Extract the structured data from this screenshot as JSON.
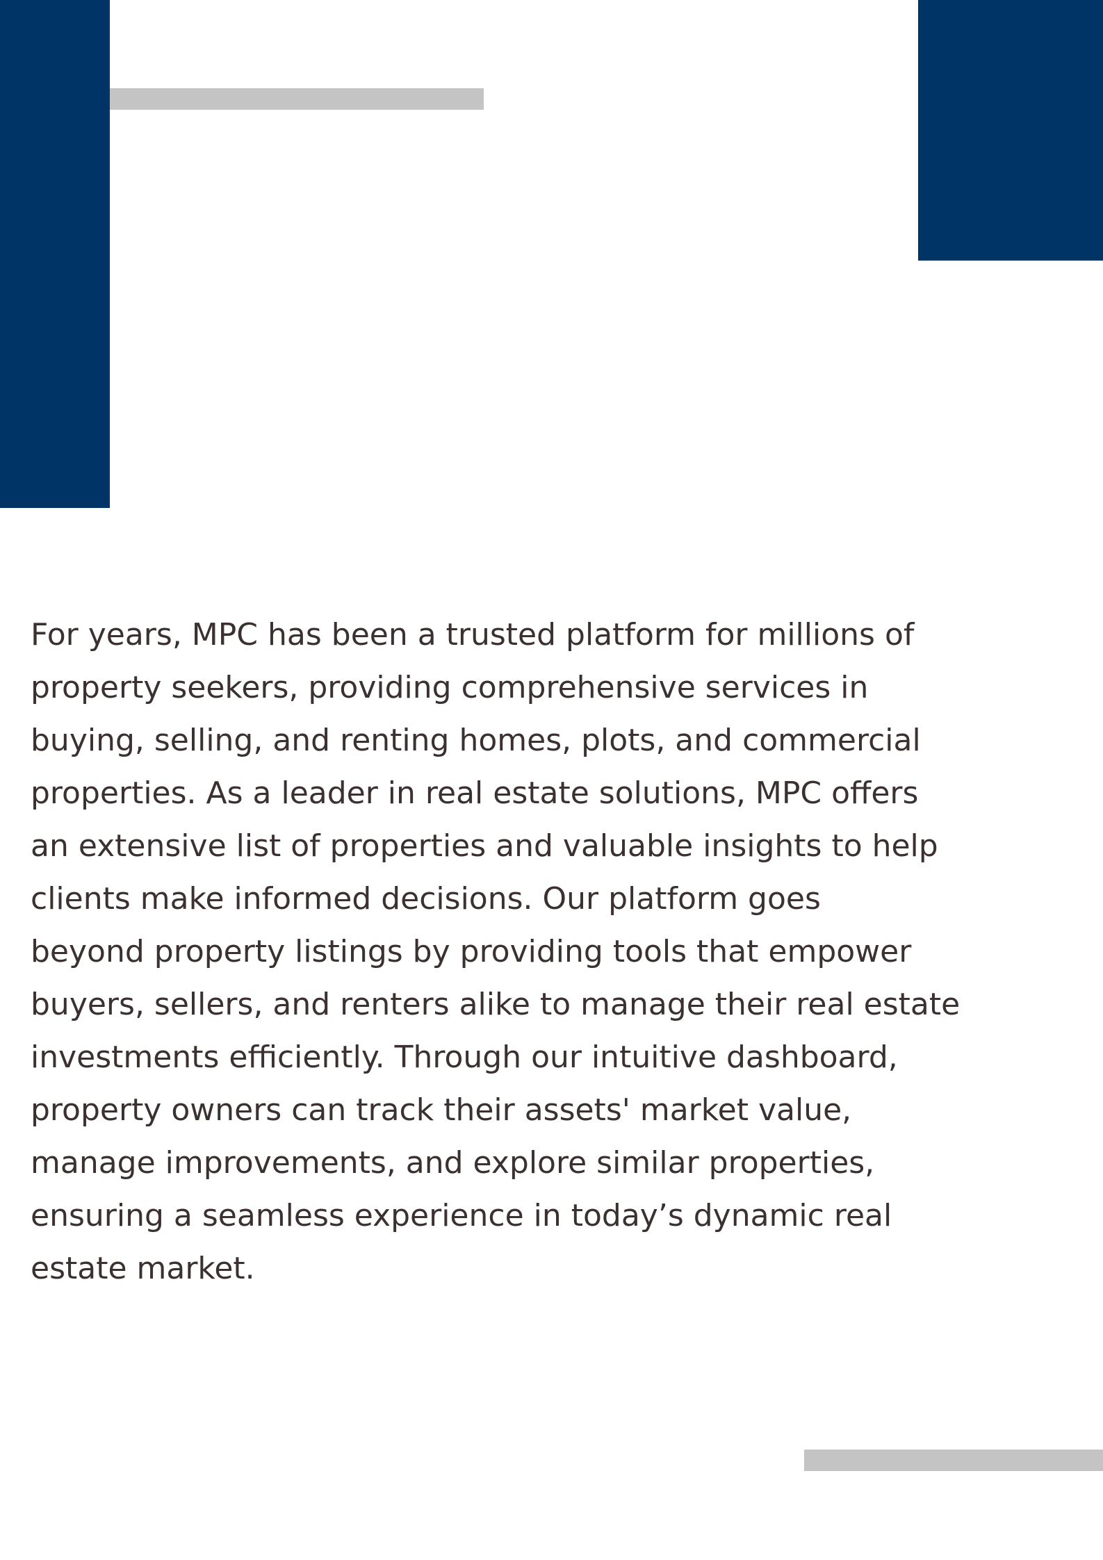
{
  "colors": {
    "navy": "#003466",
    "stripe_gray": "#c4c4c4",
    "text": "#3a3130",
    "background": "#ffffff"
  },
  "document": {
    "paragraph": "For years, MPC has been a trusted platform for millions of\nproperty seekers, providing comprehensive services in\nbuying, selling, and renting homes, plots, and commercial\nproperties. As a leader in real estate solutions, MPC offers\nan extensive list of properties and valuable insights to help\nclients make informed decisions. Our platform goes\nbeyond property listings by providing tools that empower\nbuyers, sellers, and renters alike to manage their real estate\ninvestments efficiently. Through our intuitive dashboard,\nproperty owners can track their assets' market value,\nmanage improvements, and explore similar properties,\nensuring a seamless experience in today’s dynamic real\nestate market."
  }
}
